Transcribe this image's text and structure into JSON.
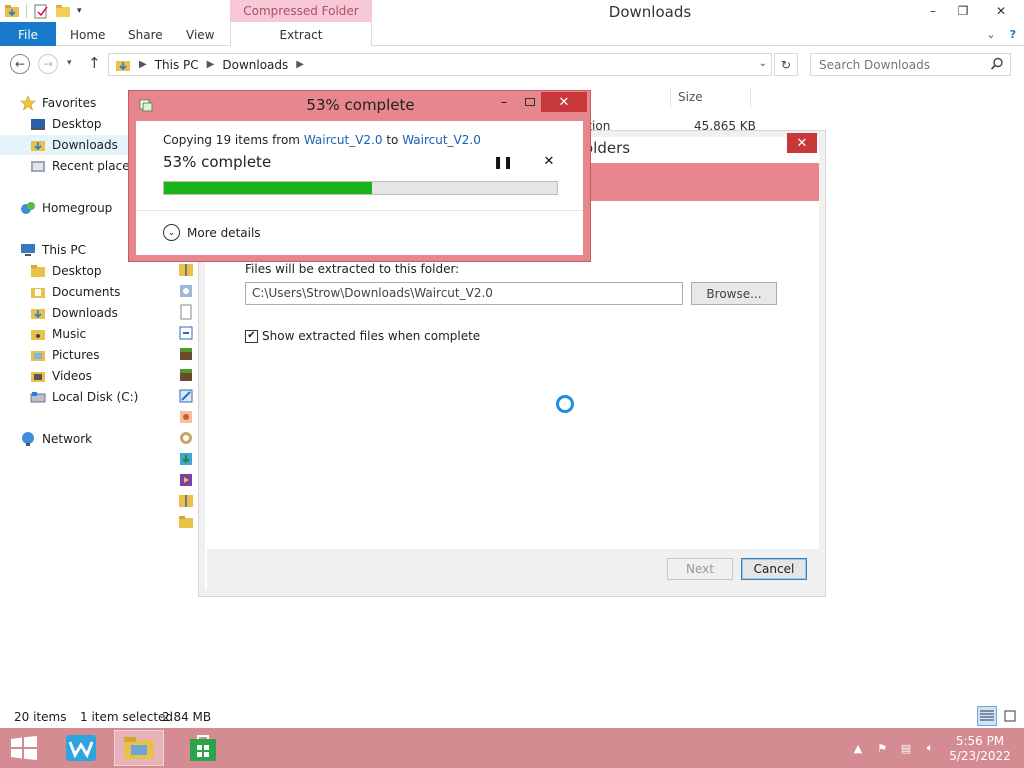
{
  "window": {
    "title": "Downloads",
    "context_tab_header": "Compressed Folder Tools",
    "minimize": "–",
    "maximize": "❐",
    "close": "✕"
  },
  "ribbon": {
    "tabs": [
      "File",
      "Home",
      "Share",
      "View"
    ],
    "context_tab": "Extract"
  },
  "address": {
    "segments": [
      "This PC",
      "Downloads"
    ],
    "search_placeholder": "Search Downloads"
  },
  "nav": {
    "favorites": "Favorites",
    "desktop": "Desktop",
    "downloads": "Downloads",
    "recent": "Recent places",
    "homegroup": "Homegroup",
    "thispc": "This PC",
    "pc_desktop": "Desktop",
    "documents": "Documents",
    "pc_downloads": "Downloads",
    "music": "Music",
    "pictures": "Pictures",
    "videos": "Videos",
    "localdisk": "Local Disk (C:)",
    "network": "Network"
  },
  "filelist": {
    "size_header": "Size",
    "type_partial": "ation",
    "size_value": "45,865 KB"
  },
  "copy_dialog": {
    "title": "53% complete",
    "line_prefix": "Copying 19 items from",
    "from": "Waircut_V2.0",
    "to_word": "to",
    "to": "Waircut_V2.0",
    "percent_text": "53% complete",
    "progress": 0.53,
    "more_details": "More details"
  },
  "extract_wizard": {
    "title_partial": "olders",
    "dest_label": "Files will be extracted to this folder:",
    "dest_path": "C:\\Users\\Strow\\Downloads\\Waircut_V2.0",
    "browse": "Browse...",
    "show_files": "Show extracted files when complete",
    "show_files_checked": true,
    "next": "Next",
    "cancel": "Cancel"
  },
  "status": {
    "items": "20 items",
    "selected": "1 item selected",
    "size": "2.84 MB"
  },
  "taskbar": {
    "time": "5:56 PM",
    "date": "5/23/2022"
  },
  "colors": {
    "accent_titlebar": "#e8868d",
    "taskbar": "#d48b92",
    "progress_fill": "#1ab51a",
    "file_tab": "#1979ca",
    "link": "#1a5fb4"
  }
}
